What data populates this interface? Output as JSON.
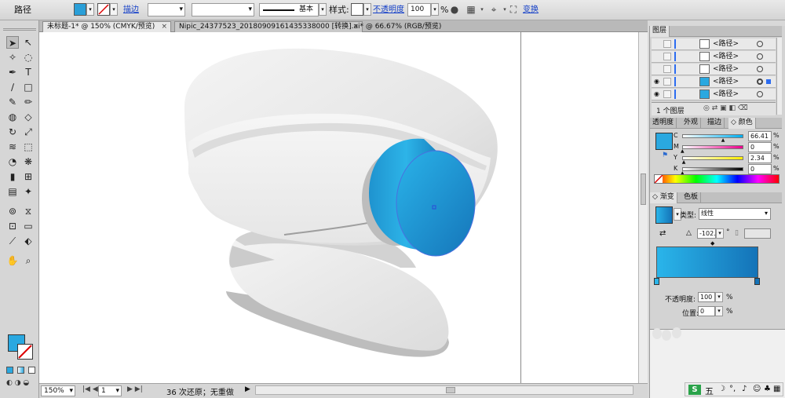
{
  "control_bar": {
    "object_type": "路径",
    "fill_color": "#2a9fd8",
    "stroke_label": "描边",
    "stroke_value": "",
    "profile_label": "基本",
    "style_label": "样式:",
    "opacity_label": "不透明度",
    "opacity_value": "100",
    "opacity_unit": "%",
    "transform_label": "变换"
  },
  "tabs": [
    {
      "label": "未标题-1* @ 150% (CMYK/预览)",
      "close": "×",
      "active": true
    },
    {
      "label": "Nipic_24377523_20180909161435338000 [转换].ai* @ 66.67% (RGB/预览)",
      "close": "×",
      "active": false
    }
  ],
  "tool_icons": [
    "selection-tool",
    "direct-selection-tool",
    "magic-wand-tool",
    "lasso-tool",
    "pen-tool",
    "type-tool",
    "line-tool",
    "rectangle-tool",
    "paintbrush-tool",
    "pencil-tool",
    "blob-brush-tool",
    "eraser-tool",
    "rotate-tool",
    "scale-tool",
    "warp-tool",
    "free-transform-tool",
    "shape-builder-tool",
    "symbol-sprayer-tool",
    "column-graph-tool",
    "mesh-tool",
    "gradient-tool",
    "eyedropper-tool",
    "blend-tool",
    "live-paint-tool",
    "live-selection-tool",
    "artboard-tool",
    "slice-tool",
    "perspective-tool",
    "hand-tool",
    "zoom-tool"
  ],
  "status_bar": {
    "zoom": "150%",
    "page": "1",
    "history": "36 次还原；无重做"
  },
  "layers_panel": {
    "title": "图层",
    "rows": [
      {
        "name": "<路径>",
        "visible": false
      },
      {
        "name": "<路径>",
        "visible": false
      },
      {
        "name": "<路径>",
        "visible": false
      },
      {
        "name": "<路径>",
        "visible": true
      },
      {
        "name": "<路径>",
        "visible": true
      }
    ],
    "footer": "1 个图层"
  },
  "color_panel": {
    "tabs": [
      "透明度",
      "外观",
      "描边",
      "颜色"
    ],
    "color": "#2aa8e0",
    "sliders": [
      {
        "channel": "C",
        "value": "66.41",
        "unit": "%",
        "level": 0.664
      },
      {
        "channel": "M",
        "value": "0",
        "unit": "%",
        "level": 0
      },
      {
        "channel": "Y",
        "value": "2.34",
        "unit": "%",
        "level": 0.023
      },
      {
        "channel": "K",
        "value": "0",
        "unit": "%",
        "level": 0
      }
    ]
  },
  "gradient_panel": {
    "tabs": [
      "渐变",
      "色板"
    ],
    "type_label": "类型:",
    "type_value": "线性",
    "angle_value": "-102.",
    "angle_unit": "°",
    "gradient_start": "#2ab5ea",
    "gradient_end": "#1473b8",
    "opacity_label": "不透明度:",
    "opacity_value": "100",
    "position_label": "位置:",
    "position_value": "0",
    "percent": "%"
  },
  "ime_bar": {
    "logo": "S",
    "mode": "五"
  }
}
